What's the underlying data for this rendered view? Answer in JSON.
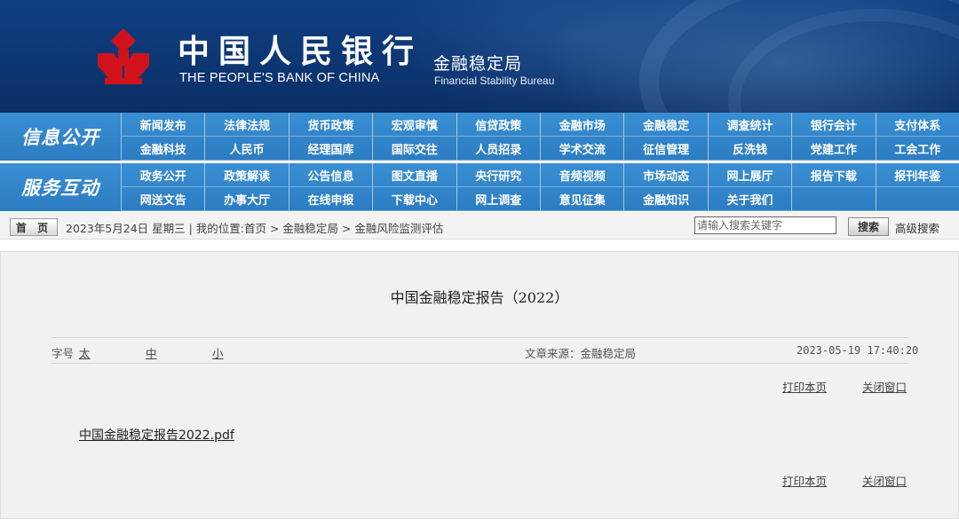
{
  "header": {
    "bank_name_cn": "中国人民银行",
    "bank_name_en": "THE PEOPLE'S BANK OF CHINA",
    "bureau_cn": "金融稳定局",
    "bureau_en": "Financial Stability Bureau",
    "colors": {
      "banner": "#0f3f82",
      "nav": "#2c7cc2",
      "emblem": "#d0121b"
    }
  },
  "nav": {
    "row1_title": "信息公开",
    "row1_items": [
      "新闻发布",
      "法律法规",
      "货币政策",
      "宏观审慎",
      "信贷政策",
      "金融市场",
      "金融稳定",
      "调查统计",
      "银行会计",
      "支付体系",
      "金融科技",
      "人民币",
      "经理国库",
      "国际交往",
      "人员招录",
      "学术交流",
      "征信管理",
      "反洗钱",
      "党建工作",
      "工会工作"
    ],
    "row2_title": "服务互动",
    "row2_items": [
      "政务公开",
      "政策解读",
      "公告信息",
      "图文直播",
      "央行研究",
      "音频视频",
      "市场动态",
      "网上展厅",
      "报告下载",
      "报刊年鉴",
      "网送文告",
      "办事大厅",
      "在线申报",
      "下载中心",
      "网上调查",
      "意见征集",
      "金融知识",
      "关于我们",
      "",
      ""
    ]
  },
  "breadcrumb": {
    "home": "首 页",
    "text": "2023年5月24日 星期三 | 我的位置:首页 > 金融稳定局 > 金融风险监测评估",
    "search_placeholder": "请输入搜索关键字",
    "search_button": "搜索",
    "advanced": "高级搜索"
  },
  "article": {
    "title": "中国金融稳定报告（2022）",
    "font_size_label": "字号",
    "font_large": "太",
    "font_medium": "中",
    "font_small": "小",
    "source": "文章来源：金融稳定局",
    "date": "2023-05-19 17:40:20",
    "print": "打印本页",
    "close": "关闭窗口",
    "attachment": "中国金融稳定报告2022.pdf"
  }
}
